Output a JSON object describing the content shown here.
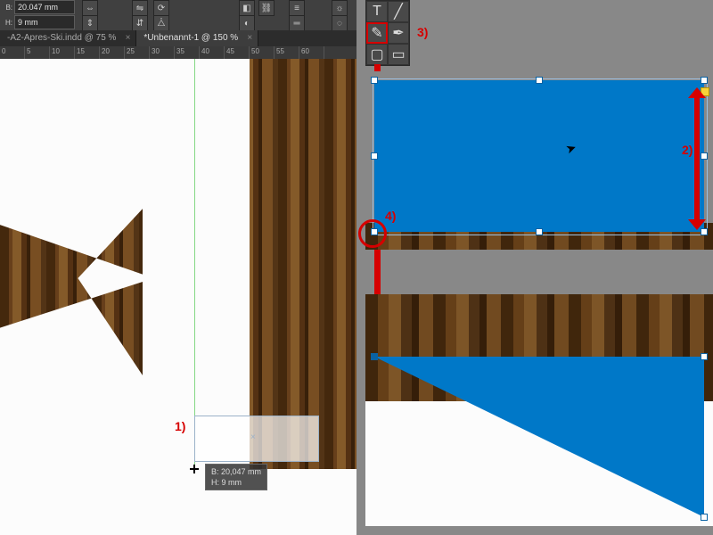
{
  "control_bar": {
    "width_label": "B:",
    "width_value": "20.047 mm",
    "height_label": "H:",
    "height_value": "9 mm"
  },
  "tabs": [
    {
      "title": "-A2-Apres-Ski.indd @ 75 %",
      "active": false
    },
    {
      "title": "*Unbenannt-1 @ 150 %",
      "active": true
    }
  ],
  "ruler_ticks": [
    "0",
    "5",
    "10",
    "15",
    "20",
    "25",
    "30",
    "35",
    "40",
    "45",
    "50",
    "55",
    "60"
  ],
  "size_readout": {
    "line_b": "B: 20,047 mm",
    "line_h": "H: 9 mm"
  },
  "annotations": {
    "step1": "1)",
    "step2": "2)",
    "step3": "3)",
    "step4": "4)"
  },
  "tool_icons": {
    "t_type": "T",
    "t_line": "╱",
    "t_eyedrop": "✎",
    "t_brush": "✒",
    "t_rect": "▢",
    "t_frame": "▭"
  },
  "cursor_glyph": "➤"
}
